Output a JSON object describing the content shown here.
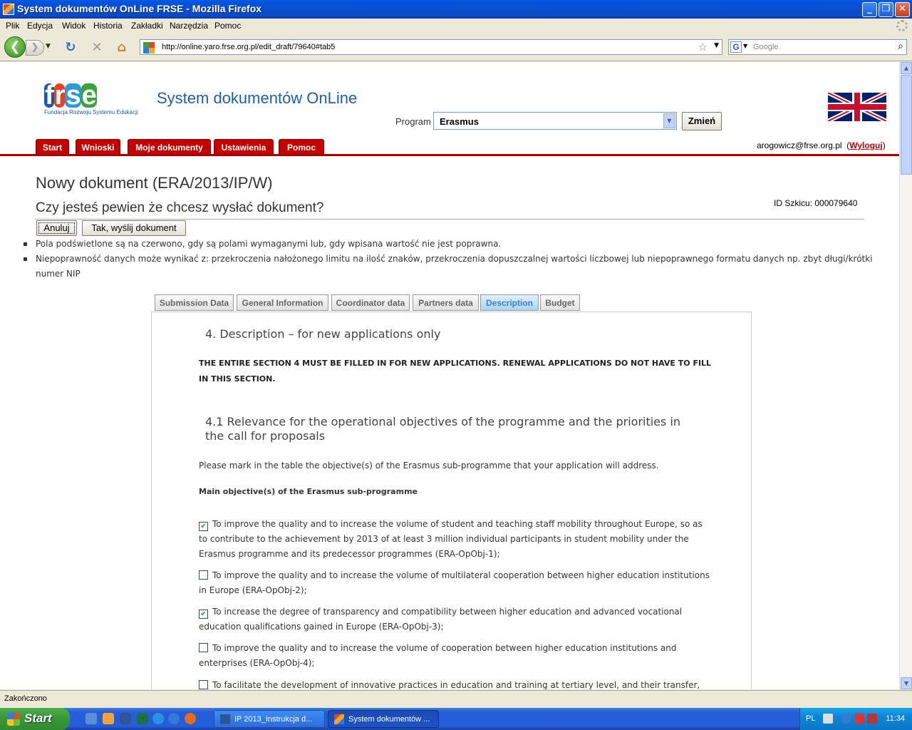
{
  "window": {
    "title": "System dokumentów OnLine FRSE - Mozilla Firefox",
    "minimize": "_",
    "maximize": "❐",
    "close": "✕"
  },
  "menu": [
    "Plik",
    "Edycja",
    "Widok",
    "Historia",
    "Zakładki",
    "Narzędzia",
    "Pomoc"
  ],
  "nav": {
    "back": "❮",
    "forward": "❯",
    "reload": "↻",
    "stop": "✕",
    "home": "⌂",
    "url": "http://online.yaro.frse.org.pl/edit_draft/79640#tab5",
    "search_engine": "G",
    "search_placeholder": "Google"
  },
  "site": {
    "logo_letters": [
      "f",
      "r",
      "s",
      "e"
    ],
    "logo_colors": [
      "#1c57a8",
      "#e8412b",
      "#2a9bd8",
      "#3aa33a"
    ],
    "logo_tagline": "Fundacja Rozwoju Systemu Edukacji",
    "title": "System dokumentów OnLine",
    "program_label": "Program",
    "program_value": "Erasmus",
    "change_button": "Zmień"
  },
  "main_tabs": [
    "Start",
    "Wnioski",
    "Moje dokumenty",
    "Ustawienia",
    "Pomoc"
  ],
  "user": {
    "email": "arogowicz@frse.org.pl",
    "logout": "Wyloguj"
  },
  "page": {
    "heading": "Nowy dokument (ERA/2013/IP/W)",
    "question": "Czy jesteś pewien że chcesz wysłać dokument?",
    "draft_id": "ID Szkicu: 000079640",
    "cancel_button": "Anuluj",
    "send_button": "Tak, wyślij dokument",
    "notes": [
      "Pola podświetlone są na czerwono, gdy są polami wymaganymi lub, gdy wpisana wartość nie jest poprawna.",
      "Niepoprawność danych może wynikać z: przekroczenia nałożonego limitu na ilość znaków, przekroczenia dopuszczalnej wartości liczbowej lub niepoprawnego formatu danych np. zbyt długi/krótki numer NIP"
    ]
  },
  "sub_tabs": [
    "Submission Data",
    "General Information",
    "Coordinator data",
    "Partners data",
    "Description",
    "Budget"
  ],
  "active_sub_tab": "Description",
  "form": {
    "section_title": "4. Description – for new applications only",
    "section_note": "THE ENTIRE SECTION 4 MUST BE FILLED IN FOR NEW APPLICATIONS. RENEWAL APPLICATIONS DO NOT HAVE TO FILL IN THIS SECTION.",
    "subsection_title": "4.1 Relevance for the operational objectives of the programme and the priorities in the call for proposals",
    "instruction": "Please mark in the table the objective(s) of the Erasmus sub-programme that your application will address.",
    "objectives_heading": "Main objective(s) of the Erasmus sub-programme",
    "objectives": [
      {
        "checked": true,
        "text": "To improve the quality and to increase the volume of student and teaching staff mobility throughout Europe, so as to contribute to the achievement by 2013 of at least 3 million individual participants in student mobility under the Erasmus programme and its predecessor programmes (ERA-OpObj-1);"
      },
      {
        "checked": false,
        "text": "To improve the quality and to increase the volume of multilateral cooperation between higher education institutions in Europe (ERA-OpObj-2);"
      },
      {
        "checked": true,
        "text": "To increase the degree of transparency and compatibility between higher education and advanced vocational education qualifications gained in Europe (ERA-OpObj-3);"
      },
      {
        "checked": false,
        "text": "To improve the quality and to increase the volume of cooperation between higher education institutions and enterprises (ERA-OpObj-4);"
      },
      {
        "checked": false,
        "text": "To facilitate the development of innovative practices in education and training at tertiary level, and their transfer, including from"
      }
    ]
  },
  "status": "Zakończono",
  "taskbar": {
    "start": "Start",
    "tasks": [
      "IP 2013_Instrukcja d...",
      "System dokumentów ..."
    ],
    "lang": "PL",
    "clock": "11:34"
  }
}
